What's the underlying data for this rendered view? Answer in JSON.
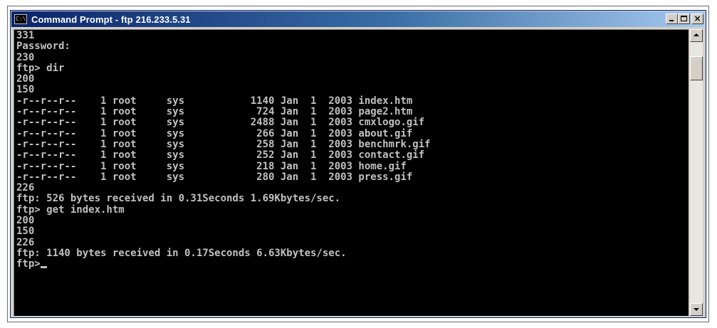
{
  "window": {
    "title": "Command Prompt - ftp 216.233.5.31",
    "icon": "console-app-icon",
    "icon_glyph": "C:\\"
  },
  "caption_buttons": {
    "minimize": "minimize-icon",
    "maximize": "maximize-icon",
    "close": "close-icon",
    "close_glyph": "×"
  },
  "console": {
    "background": "#000000",
    "foreground": "#c0c0c0",
    "lines": [
      "331",
      "Password:",
      "230",
      "ftp> dir",
      "200",
      "150",
      "-r--r--r--    1 root     sys           1140 Jan  1  2003 index.htm",
      "-r--r--r--    1 root     sys            724 Jan  1  2003 page2.htm",
      "-r--r--r--    1 root     sys           2488 Jan  1  2003 cmxlogo.gif",
      "-r--r--r--    1 root     sys            266 Jan  1  2003 about.gif",
      "-r--r--r--    1 root     sys            258 Jan  1  2003 benchmrk.gif",
      "-r--r--r--    1 root     sys            252 Jan  1  2003 contact.gif",
      "-r--r--r--    1 root     sys            218 Jan  1  2003 home.gif",
      "-r--r--r--    1 root     sys            280 Jan  1  2003 press.gif",
      "226",
      "ftp: 526 bytes received in 0.31Seconds 1.69Kbytes/sec.",
      "ftp> get index.htm",
      "200",
      "150",
      "226",
      "ftp: 1140 bytes received in 0.17Seconds 6.63Kbytes/sec.",
      "ftp>"
    ]
  },
  "scrollbar": {
    "up_icon": "scroll-up-arrow-icon",
    "down_icon": "scroll-down-arrow-icon"
  }
}
